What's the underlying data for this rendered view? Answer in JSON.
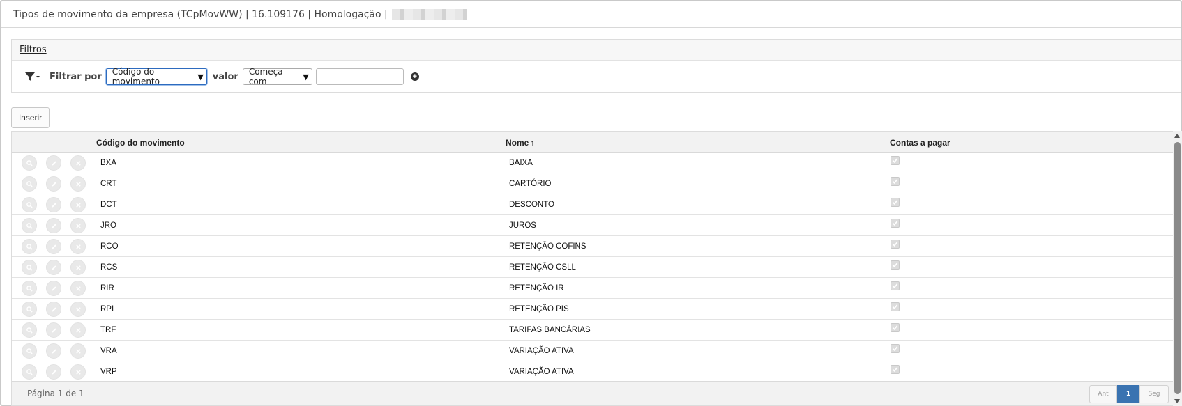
{
  "window": {
    "title": "Tipos de movimento da empresa (TCpMovWW) | 16.109176 | Homologação |"
  },
  "filters": {
    "header_label": "Filtros",
    "filter_by_label": "Filtrar por",
    "field_select_value": "Código do movimento",
    "value_label": "valor",
    "operator_select_value": "Começa com",
    "value_input": "",
    "add_filter_icon": "plus-circle-icon",
    "funnel_icon": "funnel-dropdown-icon"
  },
  "toolbar": {
    "insert_label": "Inserir"
  },
  "grid": {
    "columns": {
      "code": "Código do movimento",
      "name": "Nome",
      "accounts_payable": "Contas a pagar"
    },
    "sort_icon": "arrow-up-icon",
    "row_action_icons": [
      "search-icon",
      "edit-icon",
      "delete-icon"
    ],
    "rows": [
      {
        "code": "BXA",
        "name": "BAIXA",
        "accounts_payable": true
      },
      {
        "code": "CRT",
        "name": "CARTÓRIO",
        "accounts_payable": true
      },
      {
        "code": "DCT",
        "name": "DESCONTO",
        "accounts_payable": true
      },
      {
        "code": "JRO",
        "name": "JUROS",
        "accounts_payable": true
      },
      {
        "code": "RCO",
        "name": "RETENÇÃO COFINS",
        "accounts_payable": true
      },
      {
        "code": "RCS",
        "name": "RETENÇÃO CSLL",
        "accounts_payable": true
      },
      {
        "code": "RIR",
        "name": "RETENÇÃO IR",
        "accounts_payable": true
      },
      {
        "code": "RPI",
        "name": "RETENÇÃO PIS",
        "accounts_payable": true
      },
      {
        "code": "TRF",
        "name": "TARIFAS BANCÁRIAS",
        "accounts_payable": true
      },
      {
        "code": "VRA",
        "name": "VARIAÇÃO ATIVA",
        "accounts_payable": true
      },
      {
        "code": "VRP",
        "name": "VARIAÇÃO ATIVA",
        "accounts_payable": true
      }
    ],
    "footer": {
      "page_info": "Página 1 de 1",
      "prev_label": "Ant",
      "current_page": "1",
      "next_label": "Seg"
    }
  },
  "colors": {
    "pager_active": "#3a73b1",
    "focus_border": "#2d6bbf"
  }
}
